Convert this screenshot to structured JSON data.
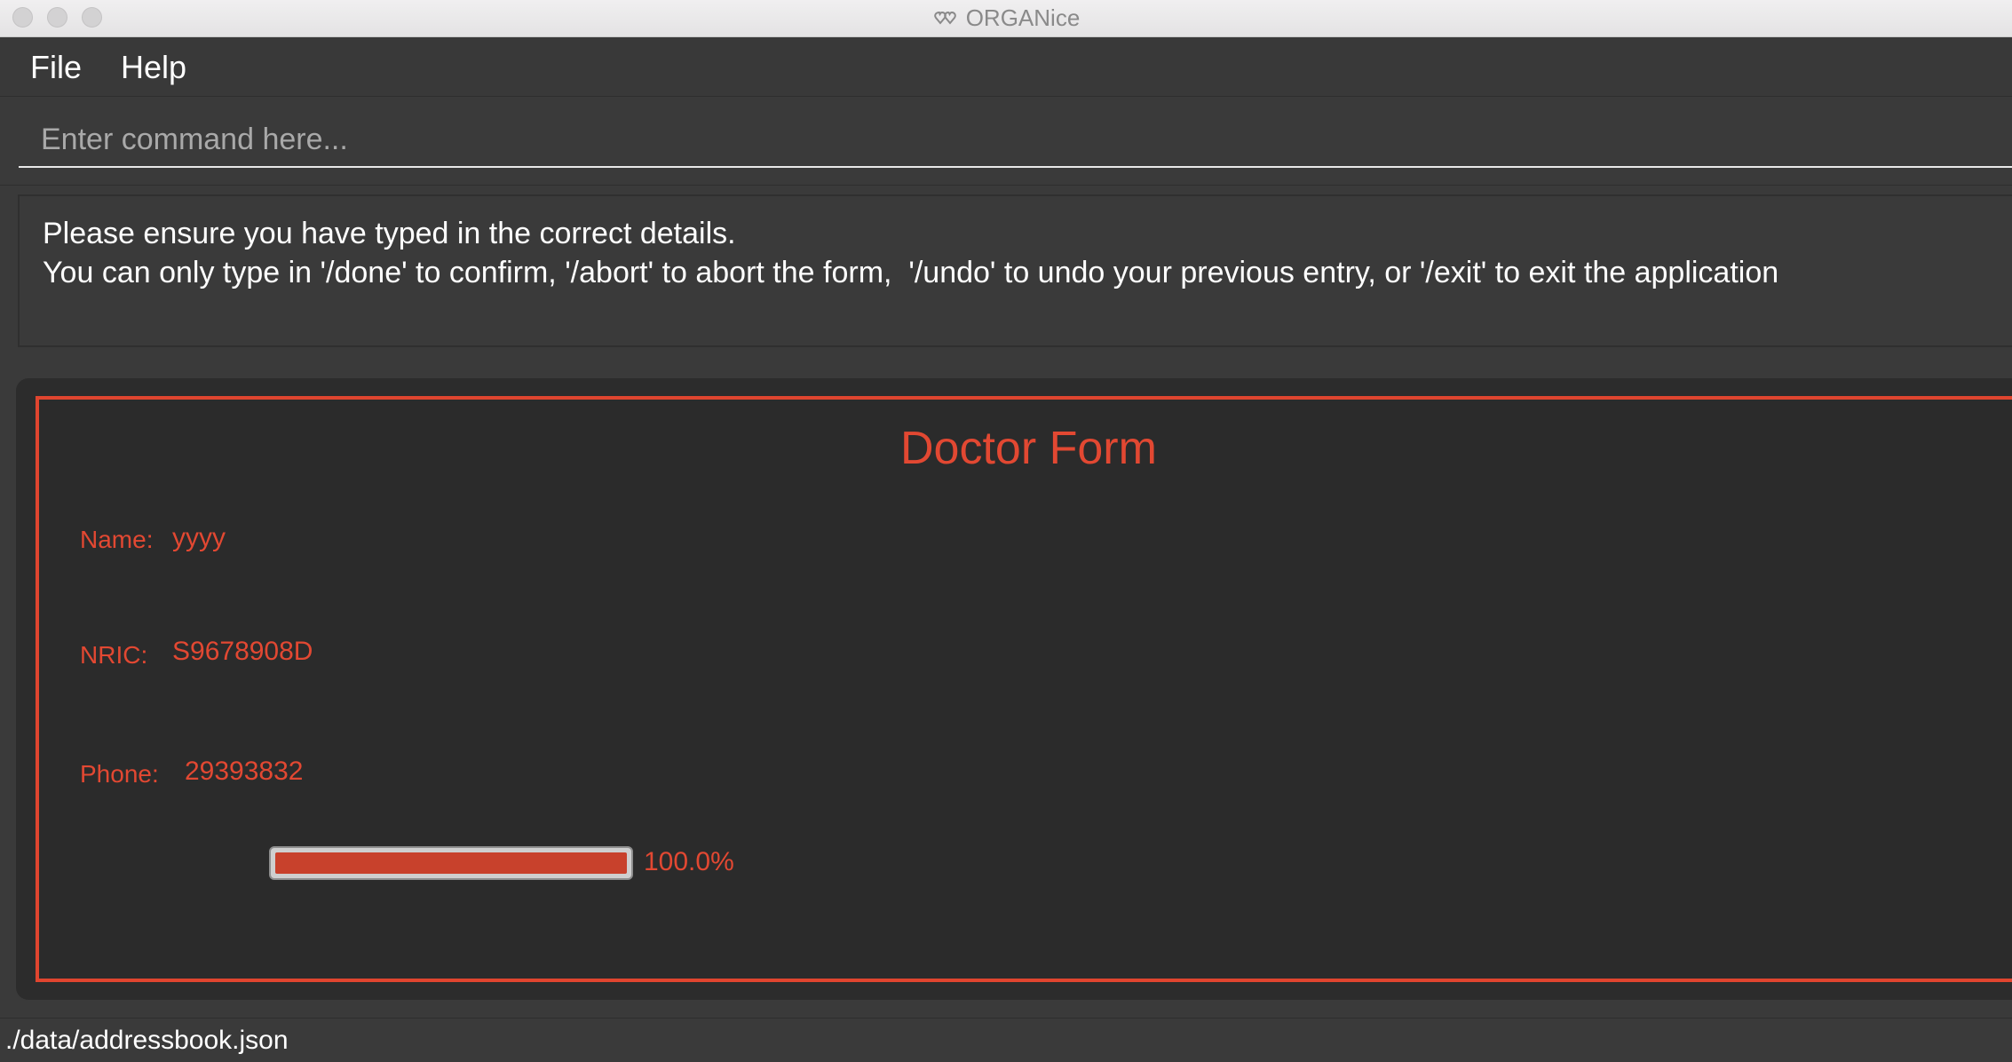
{
  "window": {
    "title": "ORGANice"
  },
  "menu": {
    "file_label": "File",
    "help_label": "Help"
  },
  "command": {
    "placeholder": "Enter command here...",
    "value": ""
  },
  "result": {
    "line1": "Please ensure you have typed in the correct details.",
    "line2": "You can only type in '/done' to confirm, '/abort' to abort the form,  '/undo' to undo your previous entry, or '/exit' to exit the application"
  },
  "form": {
    "title": "Doctor Form",
    "fields": [
      {
        "label": "Name:",
        "value": "yyyy"
      },
      {
        "label": "NRIC:",
        "value": "S9678908D"
      },
      {
        "label": "Phone:",
        "value": "29393832"
      }
    ],
    "progress": 1.0,
    "progress_text": "100.0%"
  },
  "status": {
    "file_path": "./data/addressbook.json"
  },
  "colors": {
    "accent": "#e24832",
    "background": "#3a3a3a",
    "form_background": "#2b2b2b"
  },
  "icons": {
    "app": "heart-logo-icon"
  }
}
